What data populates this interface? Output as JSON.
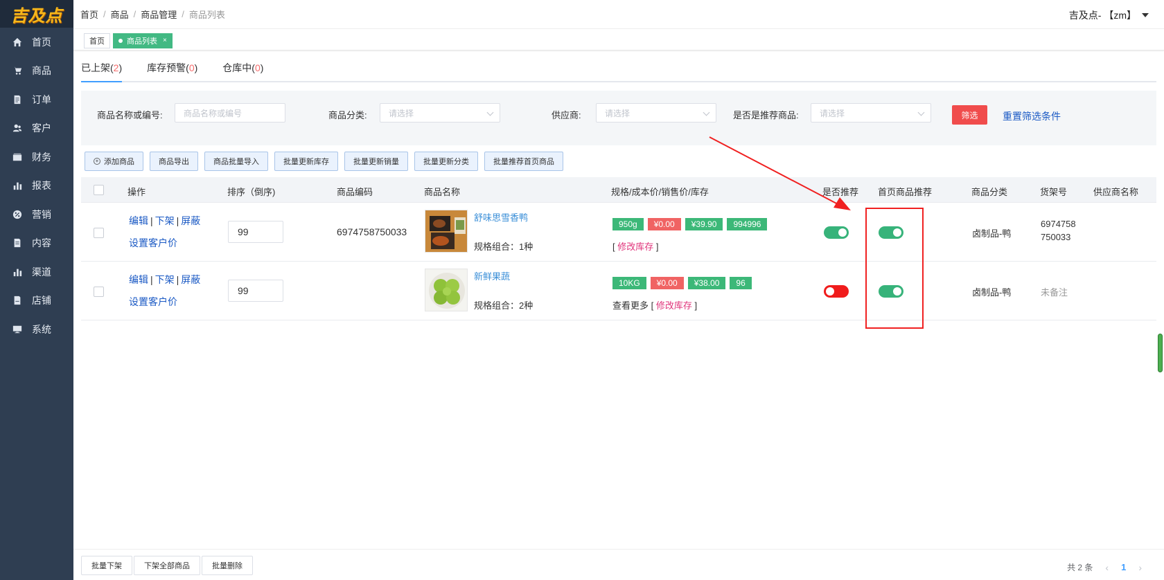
{
  "logo": {
    "text": "吉及点"
  },
  "sidebar": {
    "items": [
      {
        "label": "首页",
        "icon": "home-icon"
      },
      {
        "label": "商品",
        "icon": "cart-icon"
      },
      {
        "label": "订单",
        "icon": "order-icon"
      },
      {
        "label": "客户",
        "icon": "customer-icon"
      },
      {
        "label": "财务",
        "icon": "finance-icon"
      },
      {
        "label": "报表",
        "icon": "bar-chart-icon"
      },
      {
        "label": "营销",
        "icon": "percent-icon"
      },
      {
        "label": "内容",
        "icon": "content-icon"
      },
      {
        "label": "渠道",
        "icon": "bar-chart-icon"
      },
      {
        "label": "店铺",
        "icon": "store-icon"
      },
      {
        "label": "系统",
        "icon": "monitor-icon"
      }
    ]
  },
  "header": {
    "breadcrumb": [
      "首页",
      "商品",
      "商品管理",
      "商品列表"
    ],
    "user": "吉及点- 【zm】"
  },
  "tagbar": {
    "home": "首页",
    "active": "商品列表",
    "close": "×"
  },
  "status_tabs": {
    "on_shelf_label": "已上架(",
    "on_shelf_count": "2",
    "stock_warn_label": "库存预警(",
    "stock_warn_count": "0",
    "warehouse_label": "仓库中(",
    "warehouse_count": "0",
    "close_paren": ")"
  },
  "filter": {
    "name_label": "商品名称或编号:",
    "name_placeholder": "商品名称或编号",
    "category_label": "商品分类:",
    "category_placeholder": "请选择",
    "supplier_label": "供应商:",
    "supplier_placeholder": "请选择",
    "recommend_label": "是否是推荐商品:",
    "recommend_placeholder": "请选择",
    "filter_button": "筛选",
    "reset_link": "重置筛选条件"
  },
  "toolbar": {
    "buttons": [
      "添加商品",
      "商品导出",
      "商品批量导入",
      "批量更新库存",
      "批量更新销量",
      "批量更新分类",
      "批量推荐首页商品"
    ]
  },
  "table": {
    "columns": [
      "操作",
      "排序（倒序)",
      "商品编码",
      "商品名称",
      "规格/成本价/销售价/库存",
      "是否推荐",
      "首页商品推荐",
      "商品分类",
      "货架号",
      "供应商名称"
    ],
    "ops": {
      "edit": "编辑",
      "off": "下架",
      "hide": "屏蔽",
      "pipe": "|",
      "set_price": "设置客户价"
    },
    "rows": [
      {
        "sort": "99",
        "code": "6974758750033",
        "name": "舒味思雪香鸭",
        "spec_combo": "规格组合：1种",
        "tags": [
          "950g",
          "¥0.00",
          "¥39.90",
          "994996"
        ],
        "more": "",
        "stock_open": "[ ",
        "stock_link": "修改库存",
        "stock_close": " ]",
        "recommend": true,
        "home_recommend": true,
        "category": "卤制品-鸭",
        "shelf_line1": "6974758",
        "shelf_line2": "750033",
        "shelf_note": "",
        "supplier": ""
      },
      {
        "sort": "99",
        "code": "",
        "name": "新鲜果蔬",
        "spec_combo": "规格组合：2种",
        "tags": [
          "10KG",
          "¥0.00",
          "¥38.00",
          "96"
        ],
        "more": "查看更多",
        "stock_open": " [ ",
        "stock_link": "修改库存",
        "stock_close": " ]",
        "recommend": false,
        "home_recommend": true,
        "category": "卤制品-鸭",
        "shelf_line1": "",
        "shelf_line2": "",
        "shelf_note": "未备注",
        "supplier": ""
      }
    ]
  },
  "footer": {
    "buttons": [
      "批量下架",
      "下架全部商品",
      "批量删除"
    ],
    "total": "共 2 条",
    "page": "1",
    "prev": "‹",
    "next": "›"
  },
  "colors": {
    "sidebar": "#2f3e52",
    "accent_green": "#42b983",
    "danger_red": "#f04c4c",
    "link_blue": "#1a59c4"
  }
}
